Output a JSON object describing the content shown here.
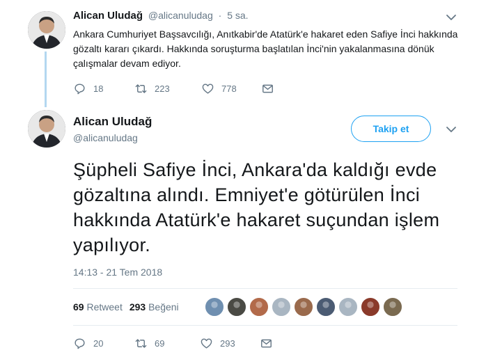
{
  "parent_tweet": {
    "name": "Alican Uludağ",
    "handle": "@alicanuludag",
    "separator": "·",
    "time": "5 sa.",
    "text": "Ankara Cumhuriyet Başsavcılığı, Anıtkabir'de Atatürk'e hakaret eden Safiye İnci hakkında gözaltı kararı çıkardı. Hakkında soruşturma başlatılan İnci'nin yakalanmasına dönük çalışmalar devam ediyor.",
    "replies": "18",
    "retweets": "223",
    "likes": "778"
  },
  "main_tweet": {
    "name": "Alican Uludağ",
    "handle": "@alicanuludag",
    "follow_label": "Takip et",
    "text": "Şüpheli Safiye İnci, Ankara'da kaldığı evde gözaltına alındı. Emniyet'e götürülen İnci hakkında Atatürk'e hakaret suçundan işlem yapılıyor.",
    "timestamp": "14:13 - 21 Tem 2018",
    "retweet_count": "69",
    "retweet_label": "Retweet",
    "like_count": "293",
    "like_label": "Beğeni",
    "replies": "20",
    "retweets": "69",
    "likes": "293"
  },
  "likers": [
    {
      "color": "#6f8fb0"
    },
    {
      "color": "#4a4a44"
    },
    {
      "color": "#b26a4a"
    },
    {
      "color": "#a9b6c2"
    },
    {
      "color": "#9a6a4c"
    },
    {
      "color": "#4b5b73"
    },
    {
      "color": "#a9b6c2"
    },
    {
      "color": "#8a3a2a"
    },
    {
      "color": "#7a6a50"
    }
  ],
  "colors": {
    "accent": "#1da1f2",
    "muted": "#657786",
    "thread_line": "#b3d7f0"
  }
}
